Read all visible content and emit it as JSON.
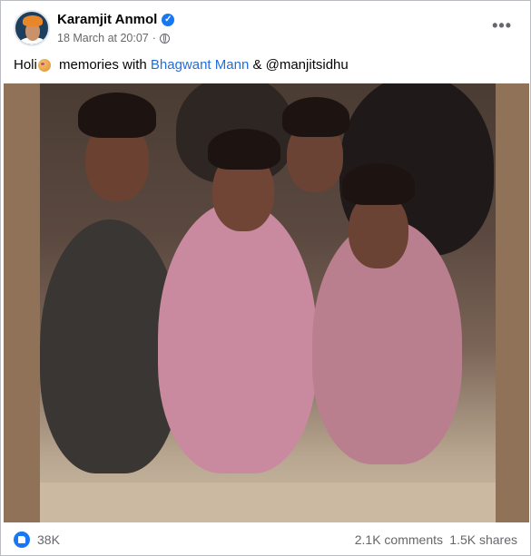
{
  "post": {
    "author": "Karamjit Anmol",
    "timestamp": "18 March at 20:07",
    "separator": "·",
    "more_label": "•••",
    "caption_prefix": "Holi",
    "caption_middle": " memories with ",
    "caption_link": "Bhagwant Mann",
    "caption_suffix": " & @manjitsidhu"
  },
  "reactions": {
    "likes": "38K",
    "comments": "2.1K comments",
    "shares": "1.5K shares"
  },
  "icons": {
    "verified": "verified-badge-icon",
    "privacy": "globe-icon",
    "more": "more-options-icon",
    "like": "like-icon"
  },
  "colors": {
    "link": "#216fdb",
    "verified": "#1877f2",
    "text_secondary": "#65676b"
  }
}
